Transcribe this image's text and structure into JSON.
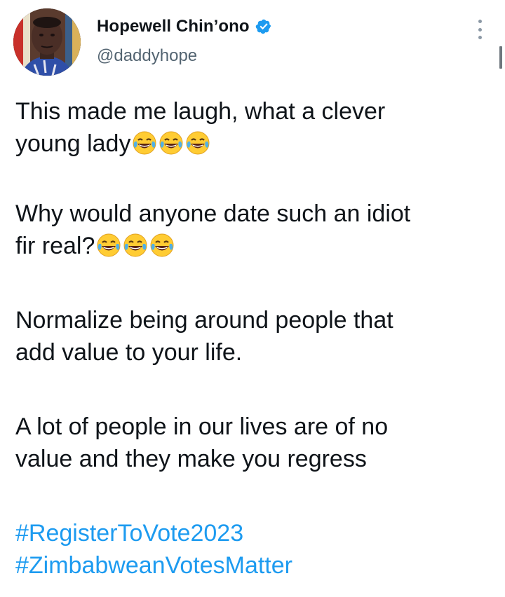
{
  "user": {
    "display_name": "Hopewell Chin’ono",
    "handle": "@daddyhope",
    "verified": true,
    "verified_color": "#1d9bf0"
  },
  "tweet": {
    "p1_line1": "This made me laugh, what a clever",
    "p1_line2": "young lady",
    "p2_line1": "Why would anyone date such an idiot",
    "p2_line2": "fir real?",
    "p3_line1": "Normalize being around people that",
    "p3_line2": "add value to your life.",
    "p4_line1": "A lot of people in our lives are of no",
    "p4_line2": "value and they make you regress",
    "hashtags": [
      "#RegisterToVote2023",
      "#ZimbabweanVotesMatter"
    ],
    "emoji": "face-with-tears-of-joy",
    "emoji_count_per_line": 3
  },
  "colors": {
    "text": "#0f1419",
    "secondary": "#536471",
    "link": "#1d9bf0"
  }
}
